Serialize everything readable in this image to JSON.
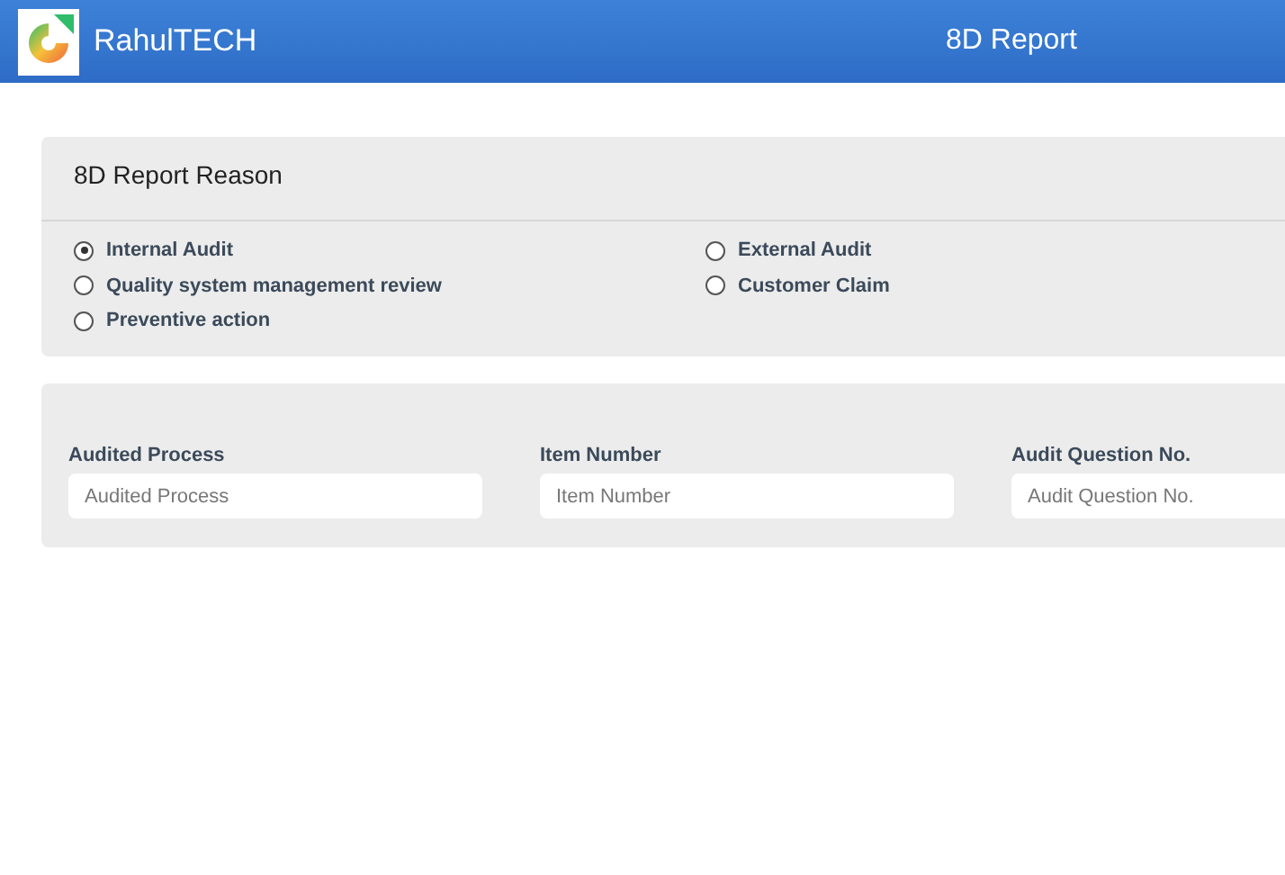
{
  "header": {
    "brand": "RahulTECH",
    "title": "8D Report"
  },
  "reason_panel": {
    "title": "8D Report Reason",
    "options": [
      {
        "label": "Internal Audit",
        "selected": true
      },
      {
        "label": "External Audit",
        "selected": false
      },
      {
        "label": "Quality system management review",
        "selected": false
      },
      {
        "label": "Customer Claim",
        "selected": false
      },
      {
        "label": "Preventive action",
        "selected": false
      }
    ]
  },
  "fields": [
    {
      "label": "Audited Process",
      "placeholder": "Audited Process"
    },
    {
      "label": "Item Number",
      "placeholder": "Item Number"
    },
    {
      "label": "Audit Question No.",
      "placeholder": "Audit Question No."
    }
  ]
}
